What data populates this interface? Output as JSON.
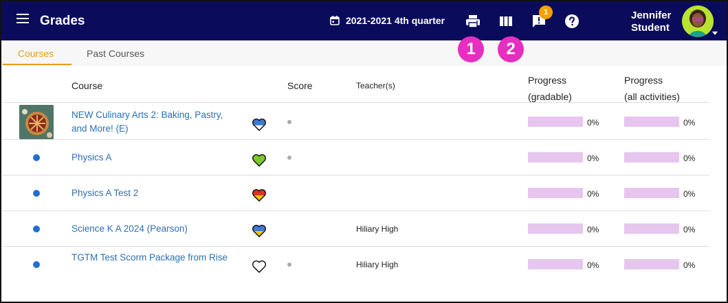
{
  "header": {
    "title": "Grades",
    "term": "2021-2021 4th quarter",
    "notification_count": "1",
    "user_name_line1": "Jennifer",
    "user_name_line2": "Student"
  },
  "tabs": [
    {
      "label": "Courses",
      "active": true
    },
    {
      "label": "Past Courses",
      "active": false
    }
  ],
  "callouts": [
    "1",
    "2"
  ],
  "columns": {
    "course": "Course",
    "score": "Score",
    "teachers": "Teacher(s)",
    "progress_gradable_line1": "Progress",
    "progress_gradable_line2": "(gradable)",
    "progress_all_line1": "Progress",
    "progress_all_line2": "(all activities)"
  },
  "courses": [
    {
      "name": "NEW Culinary Arts 2: Baking, Pastry, and More! (E)",
      "marker": "thumbnail",
      "heart": "blue-white",
      "score": "none-dot",
      "teacher": "",
      "progress_gradable": 0,
      "progress_gradable_label": "0%",
      "progress_all": 0,
      "progress_all_label": "0%"
    },
    {
      "name": "Physics A",
      "marker": "blue-dot",
      "heart": "green",
      "score": "none-dot",
      "teacher": "",
      "progress_gradable": 0,
      "progress_gradable_label": "0%",
      "progress_all": 0,
      "progress_all_label": "0%"
    },
    {
      "name": "Physics A Test 2",
      "marker": "blue-dot",
      "heart": "red-yellow",
      "score": "",
      "teacher": "",
      "progress_gradable": 0,
      "progress_gradable_label": "0%",
      "progress_all": 0,
      "progress_all_label": "0%"
    },
    {
      "name": "Science K A 2024 (Pearson)",
      "marker": "blue-dot",
      "heart": "blue-yellow",
      "score": "",
      "teacher": "Hiliary High",
      "progress_gradable": 0,
      "progress_gradable_label": "0%",
      "progress_all": 0,
      "progress_all_label": "0%"
    },
    {
      "name": "TGTM Test Scorm Package from Rise",
      "marker": "blue-dot",
      "heart": "outline",
      "score": "none-dot",
      "teacher": "Hiliary High",
      "progress_gradable": 0,
      "progress_gradable_label": "0%",
      "progress_all": 0,
      "progress_all_label": "0%"
    }
  ],
  "colors": {
    "topbar": "#0b0b5c",
    "accent_tab": "#e89a1c",
    "callout": "#e62ec1",
    "link": "#2a6fb0",
    "progress_track": "#e6c6ee",
    "notification_badge": "#f5a000"
  },
  "icons": {
    "menu": "hamburger-icon",
    "calendar": "calendar-icon",
    "print": "printer-icon",
    "columns": "columns-icon",
    "notifications": "alert-message-icon",
    "help": "help-circle-icon"
  }
}
